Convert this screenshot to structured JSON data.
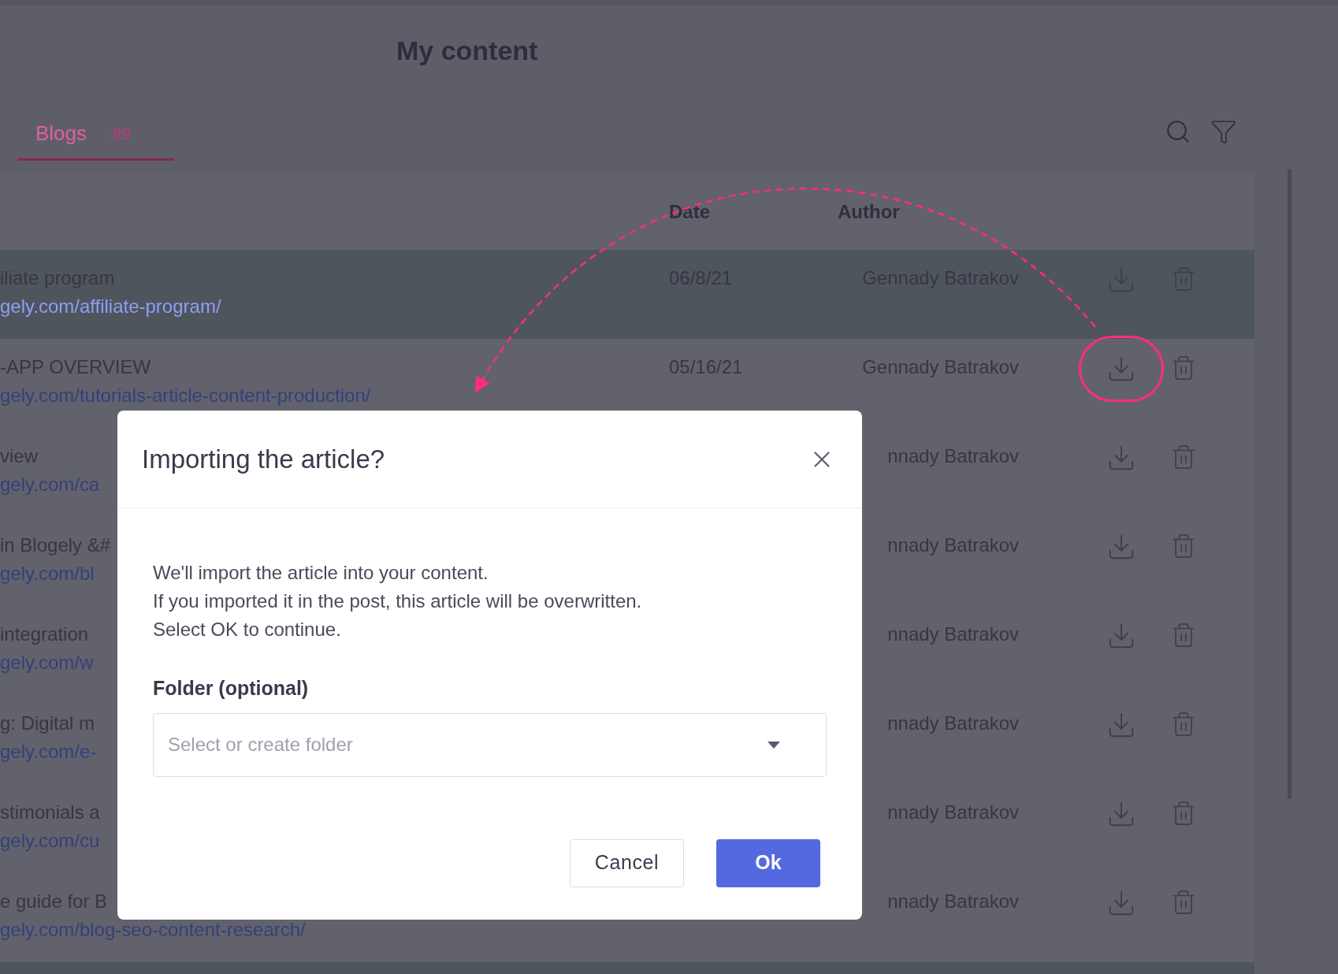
{
  "page": {
    "title": "My content"
  },
  "tabs": [
    {
      "label": "Blogs",
      "count": "89",
      "selected": true
    }
  ],
  "table": {
    "columns": [
      "Date",
      "Author"
    ],
    "rows": [
      {
        "title": "iliate program",
        "url": "gely.com/affiliate-program/",
        "date": "06/8/21",
        "author": "Gennady Batrakov",
        "highlighted": true,
        "annotated": false
      },
      {
        "title": "-APP OVERVIEW",
        "url": "gely.com/tutorials-article-content-production/",
        "date": "05/16/21",
        "author": "Gennady Batrakov",
        "highlighted": false,
        "annotated": true
      },
      {
        "title": "view",
        "url": "gely.com/ca",
        "author": "nnady Batrakov",
        "highlighted": false,
        "annotated": false
      },
      {
        "title": "in Blogely &#",
        "url": "gely.com/bl",
        "author": "nnady Batrakov",
        "highlighted": false,
        "annotated": false
      },
      {
        "title": "integration",
        "url": "gely.com/w",
        "author": "nnady Batrakov",
        "highlighted": false,
        "annotated": false
      },
      {
        "title": "g: Digital m",
        "url": "gely.com/e-",
        "author": "nnady Batrakov",
        "highlighted": false,
        "annotated": false
      },
      {
        "title": "stimonials a",
        "url": "gely.com/cu",
        "author": "nnady Batrakov",
        "highlighted": false,
        "annotated": false
      },
      {
        "title": "e guide for B",
        "url": "gely.com/blog-seo-content-research/",
        "author": "nnady Batrakov",
        "highlighted": false,
        "annotated": false
      },
      {
        "highlighted": true
      }
    ]
  },
  "dialog": {
    "title": "Importing the article?",
    "message": [
      "We'll import the article into your content.",
      "If you imported it in the post, this article will be overwritten.",
      "Select OK to continue."
    ],
    "folder_label": "Folder (optional)",
    "folder_select": {
      "placeholder": "Select or create folder"
    },
    "buttons": [
      {
        "label": "Cancel",
        "kind": "secondary"
      },
      {
        "label": "Ok",
        "kind": "primary"
      }
    ]
  }
}
